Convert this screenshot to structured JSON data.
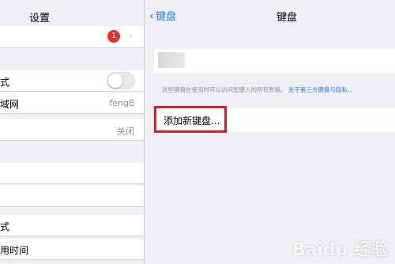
{
  "left": {
    "title": "设置",
    "badge": "1",
    "rows": [
      {
        "label": "式"
      },
      {
        "label": "域网",
        "value": "feng8"
      },
      {
        "label": "",
        "value": "关闭"
      },
      {
        "label": ""
      },
      {
        "label": ""
      },
      {
        "label": "式"
      },
      {
        "label": "用时间"
      }
    ]
  },
  "nav": {
    "back_label": "键盘",
    "title": "键盘"
  },
  "keyboards": {
    "footnote_text": "这些键盘在使用时可以访问您键入的所有数据。",
    "footnote_link": "关于第三方键盘与隐私..."
  },
  "add_keyboard": {
    "label": "添加新键盘..."
  },
  "watermark": "Baidu 经验",
  "colors": {
    "accent": "#1e7cf4",
    "badge": "#e8302e",
    "highlight": "#d9202a"
  },
  "icons": [
    "chevron-left-icon",
    "chevron-right-icon"
  ]
}
